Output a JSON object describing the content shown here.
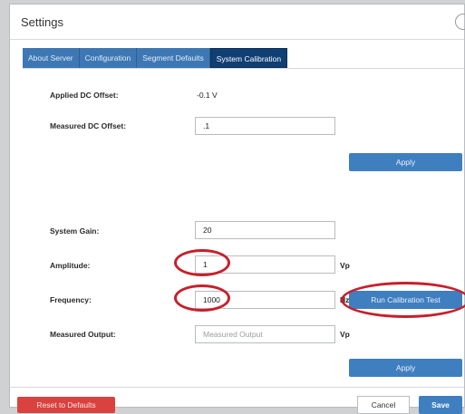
{
  "dialog": {
    "title": "Settings"
  },
  "tabs": [
    {
      "label": "About Server"
    },
    {
      "label": "Configuration"
    },
    {
      "label": "Segment Defaults"
    },
    {
      "label": "System Calibration",
      "active": true
    }
  ],
  "dc": {
    "applied_label": "Applied DC Offset:",
    "applied_value": "-0.1 V",
    "measured_label": "Measured DC Offset:",
    "measured_value": ".1",
    "apply_label": "Apply"
  },
  "calibration": {
    "gain_label": "System Gain:",
    "gain_value": "20",
    "amplitude_label": "Amplitude:",
    "amplitude_value": "1",
    "amplitude_unit": "Vp",
    "frequency_label": "Frequency:",
    "frequency_value": "1000",
    "frequency_unit": "Hz",
    "run_test_label": "Run Calibration Test",
    "output_label": "Measured Output:",
    "output_placeholder": "Measured Output",
    "output_unit": "Vp",
    "apply_label": "Apply"
  },
  "footer": {
    "reset_label": "Reset to Defaults",
    "cancel_label": "Cancel",
    "save_label": "Save"
  },
  "colors": {
    "tab": "#3d78b4",
    "tab_active": "#0f3f73",
    "primary_button": "#3f7fc0",
    "danger_button": "#d9423f",
    "highlight_oval": "#c71f2b"
  }
}
